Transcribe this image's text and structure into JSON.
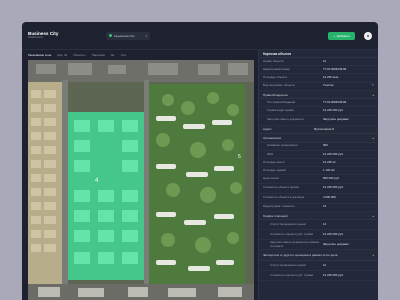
{
  "app": {
    "title": "Business City",
    "subtitle": "Dashboard"
  },
  "header": {
    "project": "Кузьминки City",
    "add_button": "Добавить",
    "avatar_initial": "A"
  },
  "tabs": [
    "Межевание зона",
    "Кад. №",
    "Объекты",
    "Парковки",
    "Зн.",
    "Ген."
  ],
  "map": {
    "selected_area_label": "4",
    "plot_label": "5",
    "highlight_color": "#3fdc96"
  },
  "panel": {
    "header": "Карточка объекта",
    "rows_top": [
      {
        "label": "Номер объекта",
        "value": "12"
      },
      {
        "label": "Кадастровый номер",
        "value": "77:01:0004049:96"
      },
      {
        "label": "Площадь объекта",
        "value": "13 225 кв.м."
      },
      {
        "label": "Вид вносимого объекта",
        "value": "Участок"
      }
    ],
    "section_rights": "Правообладатель",
    "rows_rights": [
      {
        "label": "Тип правообладания",
        "value": "77:01:0004049:96"
      },
      {
        "label": "Сумма кадастровая",
        "value": "13 225 000 руб."
      },
      {
        "label": "Загрузка самого документа",
        "value": "Загрузить документ"
      }
    ],
    "section_address": "Адрес",
    "address_value": "Бухгалтерия 9",
    "section_org": "Организация",
    "rows_org": [
      {
        "label": "Название организации",
        "value": "000"
      },
      {
        "label": "ИНН",
        "value": "13 225 000 руб."
      }
    ],
    "rows_mid": [
      {
        "label": "Площадь земли",
        "value": "13 225 м²"
      },
      {
        "label": "Площадь зданий",
        "value": "1 100 м2"
      },
      {
        "label": "Цена земли",
        "value": "500 000 руб."
      },
      {
        "label": "Стоимость объекта сделки",
        "value": "13 225 000 руб."
      },
      {
        "label": "Стоимость объекта в договоре",
        "value": "4 000 000"
      },
      {
        "label": "Кадастровая стоимость",
        "value": "13"
      }
    ],
    "section_payments": "График платежей",
    "rows_payments": [
      {
        "label": "Статус проведения оценки",
        "value": "12"
      },
      {
        "label": "Стоимость сделки в руб. Сумма",
        "value": "13 225 000 руб."
      },
      {
        "label": "Загрузка самого документа в рамках контракта",
        "value": "Загрузить документ"
      }
    ],
    "section_expertise": "Экспертиза от другого оценщика в рамках этого дела",
    "rows_expertise": [
      {
        "label": "Статус проведения оценки",
        "value": "12"
      },
      {
        "label": "Стоимость сделки в руб. Сумма",
        "value": "13 225 000 руб."
      }
    ]
  }
}
